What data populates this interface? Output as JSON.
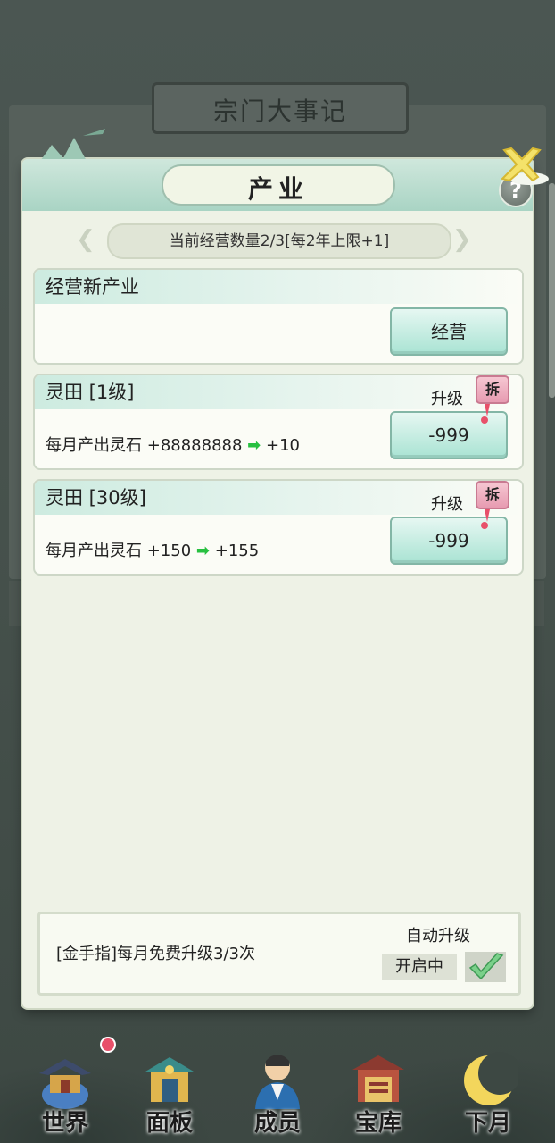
{
  "background": {
    "title": "宗门大事记"
  },
  "modal": {
    "title": "产业",
    "help": "?",
    "info": "当前经营数量2/3[每2年上限+1]",
    "new_industry": {
      "title": "经营新产业",
      "button": "经营"
    },
    "industries": [
      {
        "name": "灵田 [1级]",
        "upgrade_label": "升级",
        "demolish": "拆",
        "output_label": "每月产出灵石",
        "current": "+88888888",
        "next": "+10",
        "cost": "-999"
      },
      {
        "name": "灵田 [30级]",
        "upgrade_label": "升级",
        "demolish": "拆",
        "output_label": "每月产出灵石",
        "current": "+150",
        "next": "+155",
        "cost": "-999"
      }
    ],
    "footer": {
      "text": "[金手指]每月免费升级3/3次",
      "auto_label": "自动升级",
      "auto_state": "开启中",
      "auto_checked": true
    }
  },
  "nav": [
    {
      "label": "世界",
      "icon": "palace-icon",
      "badge": true
    },
    {
      "label": "面板",
      "icon": "gate-icon",
      "badge": false
    },
    {
      "label": "成员",
      "icon": "disciple-icon",
      "badge": false
    },
    {
      "label": "宝库",
      "icon": "treasury-icon",
      "badge": false
    },
    {
      "label": "下月",
      "icon": "moon-icon",
      "badge": false
    }
  ],
  "colors": {
    "accent_teal": "#a9e3d3",
    "arrow_green": "#27c040",
    "demolish_pink": "#e79bb1",
    "alert_red": "#e8506a"
  }
}
